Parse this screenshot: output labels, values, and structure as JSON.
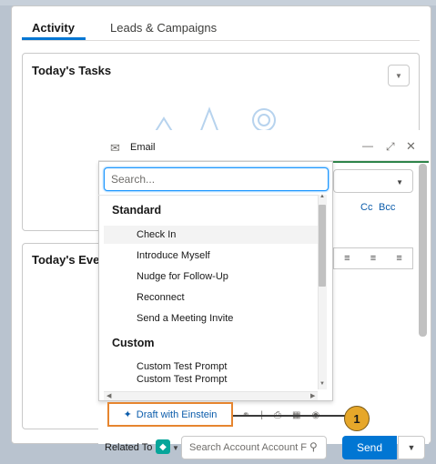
{
  "tabs": [
    {
      "label": "Activity",
      "active": true
    },
    {
      "label": "Leads & Campaigns",
      "active": false
    }
  ],
  "tasks": {
    "title": "Today's Tasks"
  },
  "events": {
    "title": "Today's Eve"
  },
  "email": {
    "title": "Email",
    "cc_label": "Cc",
    "bcc_label": "Bcc",
    "window_controls": [
      "minimize-icon",
      "expand-icon",
      "close-icon"
    ]
  },
  "template_menu": {
    "search_placeholder": "Search...",
    "groups": [
      {
        "label": "Standard",
        "items": [
          "Check In",
          "Introduce Myself",
          "Nudge for Follow-Up",
          "Reconnect",
          "Send a Meeting Invite"
        ]
      },
      {
        "label": "Custom",
        "items": [
          "Custom Test Prompt",
          "Custom Test Prompt"
        ]
      }
    ]
  },
  "draft_button": {
    "label": "Draft with Einstein",
    "icon": "sparkle-icon"
  },
  "callout": {
    "number": "1"
  },
  "footer": {
    "related_to_label": "Related To",
    "search_placeholder": "Search Account Account F",
    "send_label": "Send"
  },
  "colors": {
    "brand": "#0176d3",
    "highlight": "#e6852f",
    "callout": "#e6a72a",
    "green": "#2e844a"
  }
}
